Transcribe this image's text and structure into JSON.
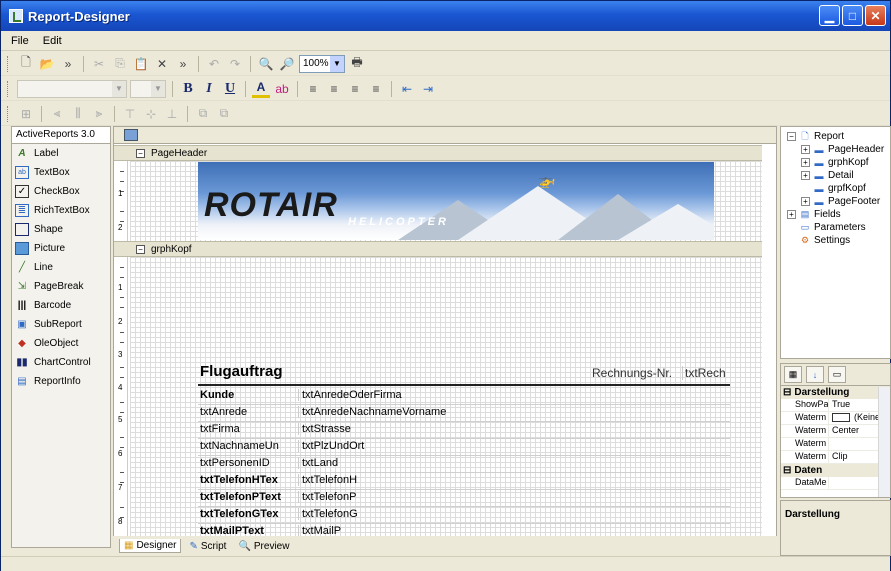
{
  "window": {
    "title": "Report-Designer"
  },
  "menu": [
    "File",
    "Edit"
  ],
  "toolbar": {
    "zoom": "100%"
  },
  "toolbox": {
    "title": "ActiveReports 3.0",
    "items": [
      "Label",
      "TextBox",
      "CheckBox",
      "RichTextBox",
      "Shape",
      "Picture",
      "Line",
      "PageBreak",
      "Barcode",
      "SubReport",
      "OleObject",
      "ChartControl",
      "ReportInfo"
    ]
  },
  "designer": {
    "bands": {
      "page_header": "PageHeader",
      "group_header": "grphKopf"
    },
    "banner": {
      "logo": "ROTAIR",
      "subtitle": "HELICOPTER"
    },
    "ruler_numbers": [
      "1",
      "2",
      "1",
      "2",
      "3",
      "4",
      "5",
      "6",
      "7",
      "8"
    ],
    "heading": {
      "title": "Flugauftrag",
      "rechnung_label": "Rechnungs-Nr.",
      "rechnung_field": "txtRech"
    },
    "rows": [
      {
        "left": "Kunde",
        "right": "txtAnredeOderFirma",
        "bold": true
      },
      {
        "left": "txtAnrede",
        "right": "txtAnredeNachnameVorname",
        "bold": false
      },
      {
        "left": "txtFirma",
        "right": "txtStrasse",
        "bold": false
      },
      {
        "left": "txtNachnameUn",
        "right": "txtPlzUndOrt",
        "bold": false
      },
      {
        "left": "txtPersonenID",
        "right": "txtLand",
        "bold": false
      },
      {
        "left": "txtTelefonHTex",
        "right": "txtTelefonH",
        "bold": true
      },
      {
        "left": "txtTelefonPText",
        "right": "txtTelefonP",
        "bold": true
      },
      {
        "left": "txtTelefonGTex",
        "right": "txtTelefonG",
        "bold": true
      },
      {
        "left": "txtMailPText",
        "right": "txtMailP",
        "bold": true
      }
    ]
  },
  "tabs": [
    "Designer",
    "Script",
    "Preview"
  ],
  "explorer": {
    "root": "Report",
    "children": [
      "PageHeader",
      "grphKopf",
      "Detail",
      "grpfKopf",
      "PageFooter"
    ],
    "others": [
      "Fields",
      "Parameters",
      "Settings"
    ]
  },
  "properties": {
    "cat1": "Darstellung",
    "rows1": [
      {
        "name": "ShowPa",
        "value": "True"
      },
      {
        "name": "Waterm",
        "value": "(Keine"
      },
      {
        "name": "Waterm",
        "value": "Center"
      },
      {
        "name": "Waterm",
        "value": ""
      },
      {
        "name": "Waterm",
        "value": "Clip"
      }
    ],
    "cat2": "Daten",
    "rows2": [
      {
        "name": "DataMe",
        "value": ""
      }
    ],
    "description": "Darstellung"
  }
}
